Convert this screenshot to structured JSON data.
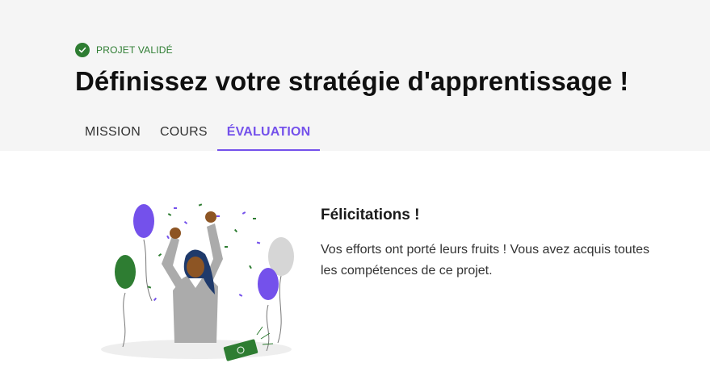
{
  "header": {
    "status_label": "PROJET VALIDÉ",
    "title": "Définissez votre stratégie d'apprentissage !",
    "tabs": [
      {
        "label": "MISSION",
        "active": false
      },
      {
        "label": "COURS",
        "active": false
      },
      {
        "label": "ÉVALUATION",
        "active": true
      }
    ]
  },
  "main": {
    "congrats_title": "Félicitations !",
    "congrats_text": "Vos efforts ont porté leurs fruits ! Vous avez acquis toutes les compétences de ce projet."
  },
  "colors": {
    "accent": "#7451eb",
    "success": "#2e7d32",
    "header_bg": "#f5f5f5"
  },
  "icons": {
    "status": "check-circle-icon"
  }
}
